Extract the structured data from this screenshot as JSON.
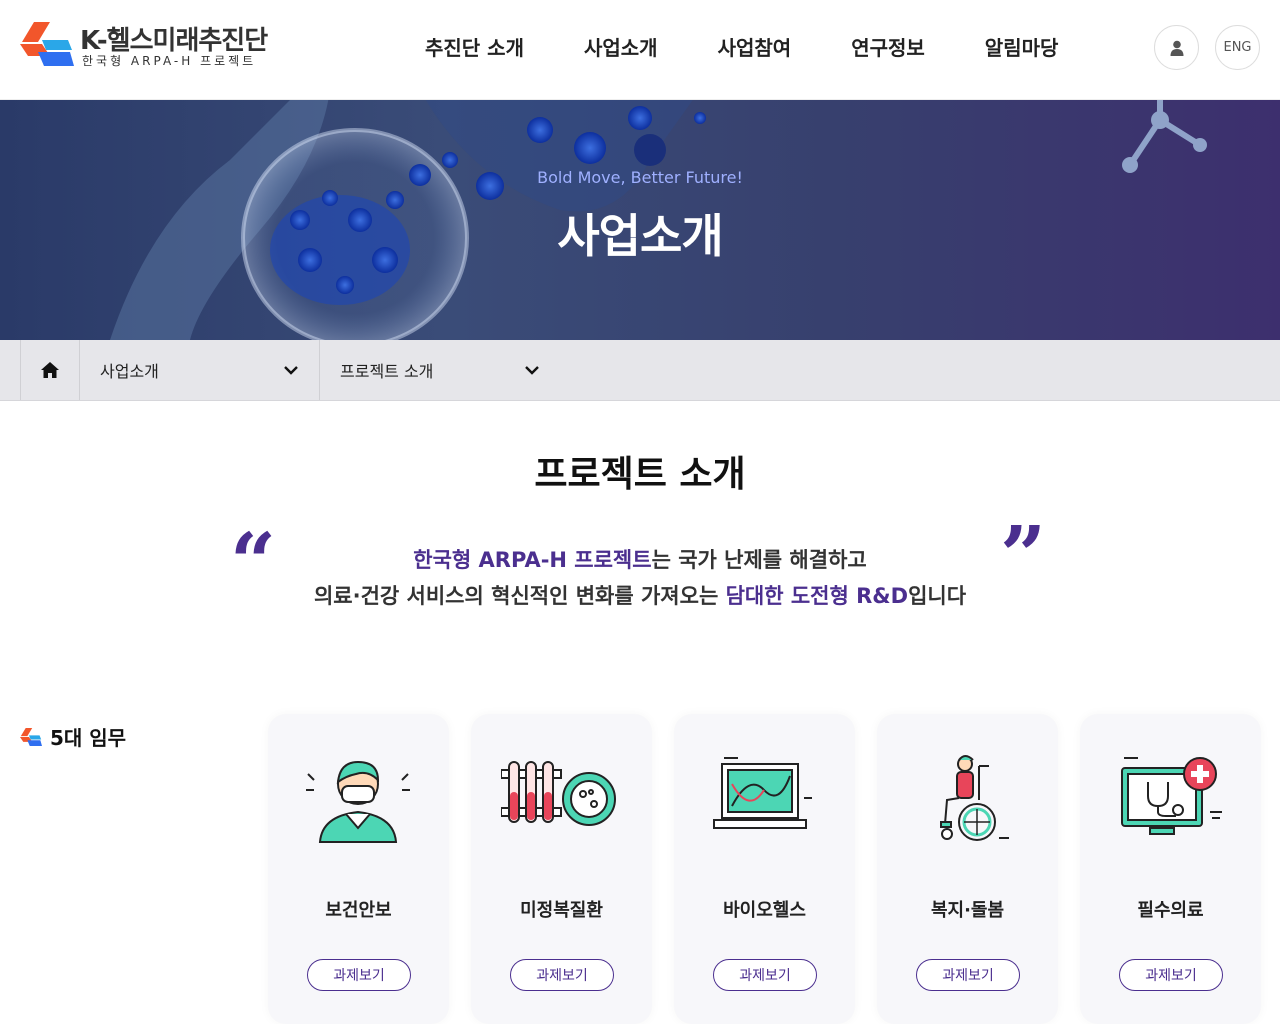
{
  "header": {
    "logo_title": "K-헬스미래추진단",
    "logo_sub": "한국형 ARPA-H 프로젝트",
    "nav": [
      "추진단 소개",
      "사업소개",
      "사업참여",
      "연구정보",
      "알림마당"
    ],
    "lang_label": "ENG"
  },
  "hero": {
    "subtitle": "Bold Move, Better Future!",
    "title": "사업소개"
  },
  "breadcrumb": {
    "level1": "사업소개",
    "level2": "프로젝트 소개"
  },
  "content": {
    "page_title": "프로젝트 소개",
    "quote": {
      "line1_accent": "한국형 ARPA-H 프로젝트",
      "line1_rest": "는 국가 난제를 해결하고",
      "line2_start": "의료·건강 서비스의 혁신적인 변화를 가져오는 ",
      "line2_accent": "담대한 도전형 R&D",
      "line2_end": "입니다"
    },
    "missions_label": "5대 임무",
    "missions": [
      {
        "name": "보건안보",
        "button": "과제보기",
        "icon": "masked-person-icon"
      },
      {
        "name": "미정복질환",
        "button": "과제보기",
        "icon": "test-tubes-petri-icon"
      },
      {
        "name": "바이오헬스",
        "button": "과제보기",
        "icon": "laptop-dna-icon"
      },
      {
        "name": "복지·돌봄",
        "button": "과제보기",
        "icon": "wheelchair-person-icon"
      },
      {
        "name": "필수의료",
        "button": "과제보기",
        "icon": "monitor-stethoscope-icon"
      }
    ]
  },
  "colors": {
    "accent": "#4b2f8f",
    "hero_sub": "#9fb0ff",
    "logo_orange": "#f2562b",
    "logo_blue": "#2f6ff0"
  }
}
